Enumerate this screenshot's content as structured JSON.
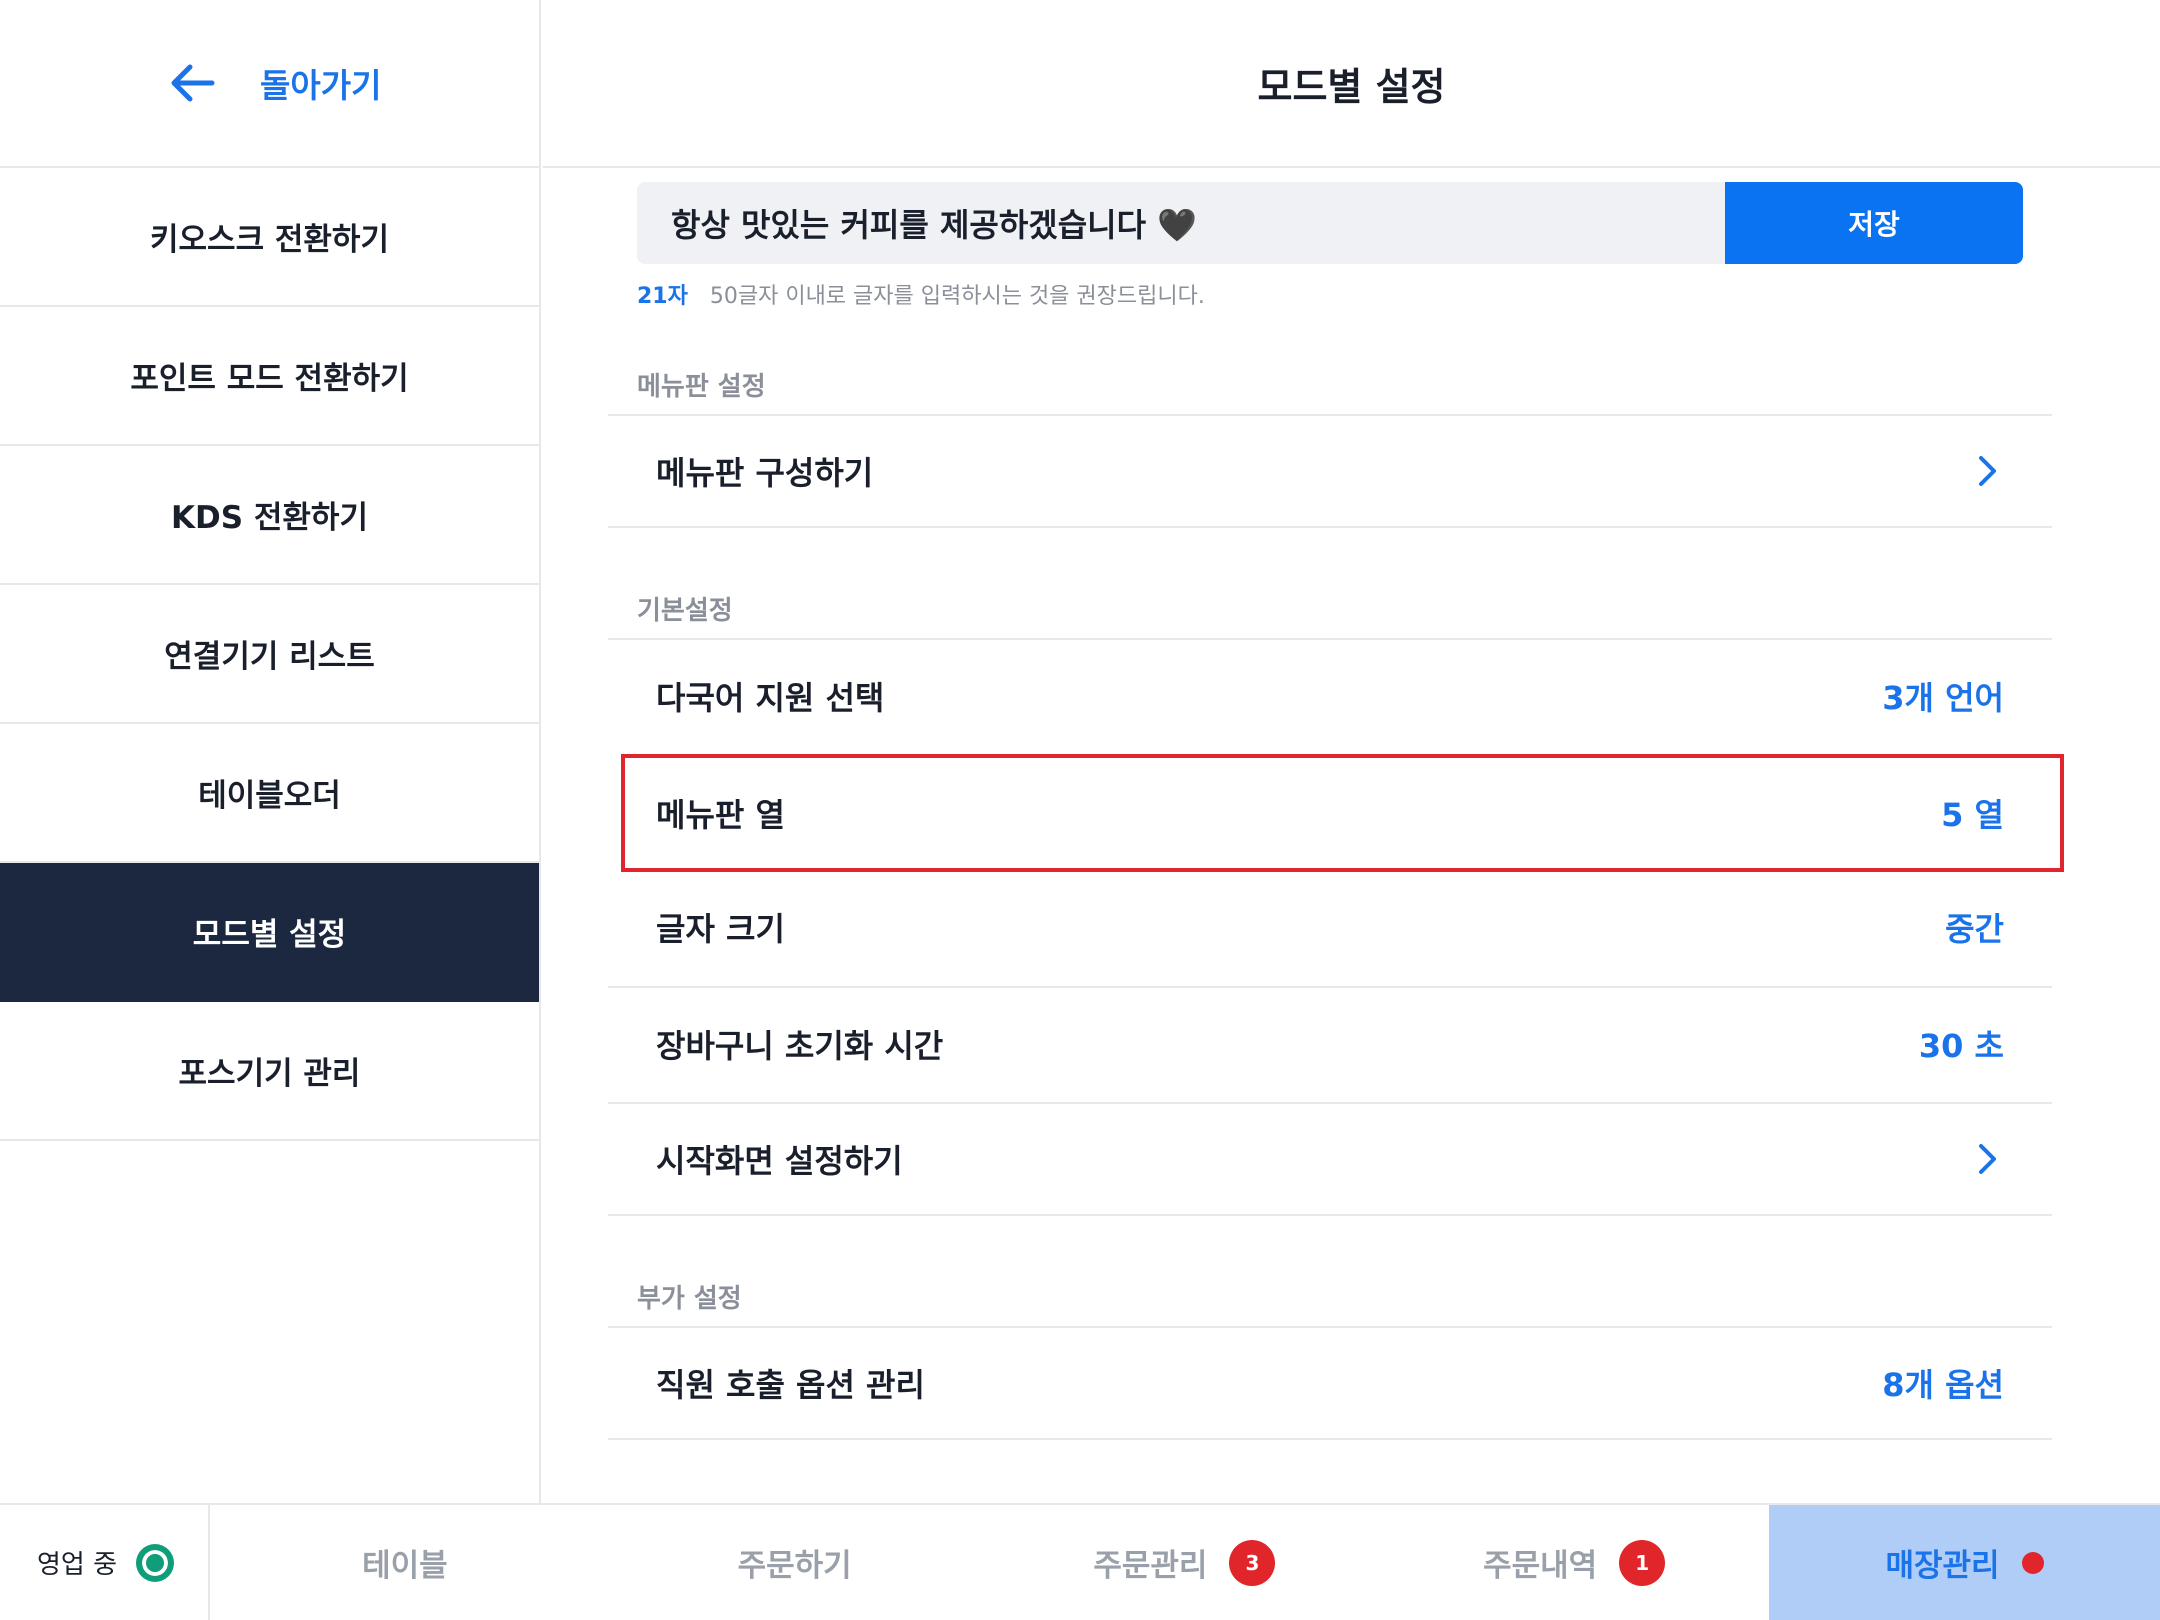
{
  "sidebar": {
    "back_label": "돌아가기",
    "items": [
      {
        "label": "키오스크 전환하기"
      },
      {
        "label": "포인트 모드 전환하기"
      },
      {
        "label": "KDS 전환하기"
      },
      {
        "label": "연결기기 리스트"
      },
      {
        "label": "테이블오더"
      },
      {
        "label": "모드별 설정",
        "active": true
      },
      {
        "label": "포스기기 관리"
      }
    ]
  },
  "header": {
    "title": "모드별 설정"
  },
  "message": {
    "value": "항상 맛있는 커피를 제공하겠습니다 🖤",
    "save_label": "저장",
    "count": "21자",
    "hint": "50글자 이내로 글자를 입력하시는 것을 권장드립니다."
  },
  "sections": {
    "menu_board": {
      "label": "메뉴판 설정",
      "rows": [
        {
          "label": "메뉴판 구성하기",
          "icon": "chevron-right-icon"
        }
      ]
    },
    "basic": {
      "label": "기본설정",
      "rows": [
        {
          "label": "다국어 지원 선택",
          "value": "3개 언어"
        },
        {
          "label": "메뉴판 열",
          "value": "5 열"
        },
        {
          "label": "글자 크기",
          "value": "중간"
        },
        {
          "label": "장바구니 초기화 시간",
          "value": "30 초"
        },
        {
          "label": "시작화면 설정하기",
          "icon": "chevron-right-icon"
        }
      ]
    },
    "extra": {
      "label": "부가 설정",
      "rows": [
        {
          "label": "직원 호출 옵션 관리",
          "value": "8개 옵션"
        }
      ]
    }
  },
  "bottom_bar": {
    "status": "영업 중",
    "tabs": [
      {
        "label": "테이블"
      },
      {
        "label": "주문하기"
      },
      {
        "label": "주문관리",
        "badge": "3"
      },
      {
        "label": "주문내역",
        "badge": "1"
      },
      {
        "label": "매장관리",
        "active": true
      }
    ]
  },
  "colors": {
    "accent": "#1a73e8",
    "sidebar_active": "#1c2840",
    "badge": "#e0262b",
    "status": "#0f9d7a"
  }
}
